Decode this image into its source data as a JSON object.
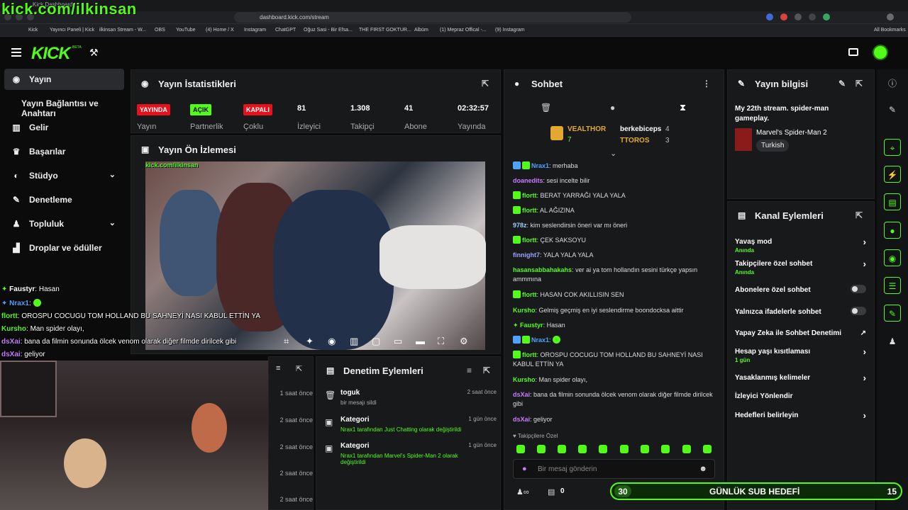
{
  "browser": {
    "tab_title": "Kick Dashboard",
    "url": "dashboard.kick.com/stream",
    "bookmarks": [
      "Kick",
      "Yayıncı Paneli | Kick",
      "ilkinsan Stream - W...",
      "OBS",
      "YouTube",
      "(4) Home / X",
      "Instagram",
      "ChatGPT",
      "Oğuz Sasi - Bir Efsa...",
      "THE FIRST GOKTUR...",
      "Albüm",
      "(1) Mepraz Offical -...",
      "(9) Instagram"
    ],
    "all_bookmarks": "All Bookmarks"
  },
  "overlay_title": "kick.com/ilkinsan",
  "logo": "KICK",
  "logo_beta": "BETA",
  "sidebar": {
    "items": [
      {
        "label": "Yayın"
      },
      {
        "label": "Yayın Bağlantısı ve Anahtarı"
      },
      {
        "label": "Gelir"
      },
      {
        "label": "Başarılar"
      },
      {
        "label": "Stüdyo"
      },
      {
        "label": "Denetleme"
      },
      {
        "label": "Topluluk"
      },
      {
        "label": "Droplar ve ödüller"
      }
    ]
  },
  "stats": {
    "title": "Yayın İstatistikleri",
    "items": [
      {
        "value": "YAYINDA",
        "label": "Yayın"
      },
      {
        "value": "AÇIK",
        "label": "Partnerlik"
      },
      {
        "value": "KAPALI",
        "label": "Çoklu"
      },
      {
        "value": "81",
        "label": "İzleyici"
      },
      {
        "value": "1.308",
        "label": "Takipçi"
      },
      {
        "value": "41",
        "label": "Abone"
      },
      {
        "value": "02:32:57",
        "label": "Yayında"
      }
    ]
  },
  "preview": {
    "title": "Yayın Ön İzlemesi",
    "watermark": "kick.com/ilkinsan"
  },
  "overlay_chat": [
    {
      "user": "Faustyr",
      "msg": "Hasan",
      "color": "#53fc18"
    },
    {
      "user": "Nrax1",
      "msg": "",
      "color": "#4da3ff"
    },
    {
      "user": "flortt",
      "msg": "OROSPU COCUGU TOM HOLLAND BU SAHNEYİ NASI KABUL ETTİN YA",
      "color": "#53fc18"
    },
    {
      "user": "Kursho",
      "msg": "Man spider olayı,",
      "color": "#53fc18"
    },
    {
      "user": "dsXai",
      "msg": "bana da filmin sonunda ölcek venom olarak diğer filmde dirilcek gibi",
      "color": "#c77dff"
    },
    {
      "user": "dsXai",
      "msg": "geliyor",
      "color": "#c77dff"
    }
  ],
  "recent_events": {
    "times": [
      "1 saat önce",
      "2 saat önce",
      "2 saat önce",
      "2 saat önce",
      "2 saat önce"
    ]
  },
  "moderation": {
    "title": "Denetim Eylemleri",
    "items": [
      {
        "title": "toguk",
        "desc": "bir mesajı sildi",
        "time": "2 saat önce"
      },
      {
        "title": "Kategori",
        "desc": "Nrax1 tarafından Just Chatting olarak değiştirildi",
        "time": "1 gün önce"
      },
      {
        "title": "Kategori",
        "desc": "Nrax1 tarafından Marvel's Spider-Man 2 olarak değiştirildi",
        "time": "1 gün önce"
      }
    ]
  },
  "chat": {
    "title": "Sohbet",
    "top_gifters": [
      {
        "name": "VEALTHOR",
        "count": "7"
      },
      {
        "name": "berkebiceps",
        "count": "4"
      },
      {
        "name": "TTOROS",
        "count": "3"
      }
    ],
    "messages": [
      {
        "user": "Nrax1",
        "msg": "merhaba",
        "color": "#4da3ff"
      },
      {
        "user": "doanedits",
        "msg": "sesi incelte bilir",
        "color": "#c77dff"
      },
      {
        "user": "flortt",
        "msg": "BERAT YARRAĞI YALA YALA",
        "color": "#53fc18"
      },
      {
        "user": "flortt",
        "msg": "AL AĞIZINA",
        "color": "#53fc18"
      },
      {
        "user": "978z",
        "msg": "kim seslendirsin öneri var mı öneri",
        "color": "#9ad0ff"
      },
      {
        "user": "flortt",
        "msg": "ÇEK SAKSOYU",
        "color": "#53fc18"
      },
      {
        "user": "finnight7",
        "msg": "YALA YALA YALA",
        "color": "#9aa3ff"
      },
      {
        "user": "hasansabbahakahs",
        "msg": "ver ai ya tom hollandın sesini türkçe yapsın ammmına",
        "color": "#53fc18"
      },
      {
        "user": "flortt",
        "msg": "HASAN COK AKILLISIN SEN",
        "color": "#53fc18"
      },
      {
        "user": "Kursho",
        "msg": "Gelmiş geçmiş en iyi seslendirme boondocksa aittir",
        "color": "#53fc18"
      },
      {
        "user": "Faustyr",
        "msg": "Hasan",
        "color": "#53fc18"
      },
      {
        "user": "Nrax1",
        "msg": "",
        "color": "#4da3ff"
      },
      {
        "user": "flortt",
        "msg": "OROSPU COCUGU TOM HOLLAND BU SAHNEYİ NASI KABUL ETTİN YA",
        "color": "#53fc18"
      },
      {
        "user": "Kursho",
        "msg": "Man spider olayı,",
        "color": "#53fc18"
      },
      {
        "user": "dsXai",
        "msg": "bana da filmin sonunda ölcek venom olarak diğer filmde dirilcek gibi",
        "color": "#c77dff"
      },
      {
        "user": "dsXai",
        "msg": "geliyor",
        "color": "#c77dff"
      }
    ],
    "followers_only": "Takipçilere Özel",
    "input_placeholder": "Bir mesaj gönderin",
    "viewer_count": "0"
  },
  "stream_info": {
    "title": "Yayın bilgisi",
    "stream_title": "My 22th stream. spider-man gameplay.",
    "category": "Marvel's Spider-Man 2",
    "language": "Turkish"
  },
  "channel_actions": {
    "title": "Kanal Eylemleri",
    "items": [
      {
        "label": "Yavaş mod",
        "sub": "Anında"
      },
      {
        "label": "Takipçilere özel sohbet",
        "sub": "Anında"
      },
      {
        "label": "Abonelere özel sohbet",
        "sub": ""
      },
      {
        "label": "Yalnızca ifadelerle sohbet",
        "sub": ""
      },
      {
        "label": "Yapay Zeka ile Sohbet Denetimi",
        "sub": ""
      },
      {
        "label": "Hesap yaşı kısıtlaması",
        "sub": "1 gün"
      },
      {
        "label": "Yasaklanmış kelimeler",
        "sub": ""
      },
      {
        "label": "İzleyici Yönlendir",
        "sub": ""
      },
      {
        "label": "Hedefleri belirleyin",
        "sub": ""
      }
    ]
  },
  "sub_goal": {
    "current": "30",
    "label": "GÜNLÜK SUB HEDEFİ",
    "target": "15"
  },
  "colors": {
    "accent": "#53fc18",
    "live_red": "#e5121d",
    "panel_bg": "#18191b"
  }
}
